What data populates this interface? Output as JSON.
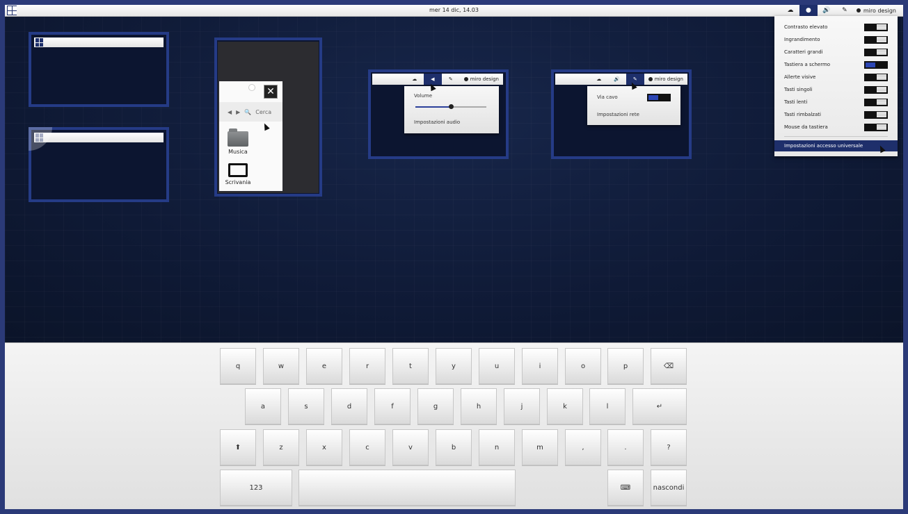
{
  "topbar": {
    "clock": "mer 14 dic, 14.03",
    "user": "miro design",
    "tray_icons": [
      "cloud-icon",
      "accessibility-icon",
      "volume-icon",
      "pencil-icon"
    ]
  },
  "file_manager": {
    "search": "Cerca",
    "items": [
      "Musica",
      "Scrivania"
    ]
  },
  "volume_popup": {
    "user": "miro design",
    "title": "Volume",
    "volume_level": 0.5,
    "settings": "Impostazioni audio"
  },
  "network_popup": {
    "user": "miro design",
    "wired": "Via cavo",
    "settings": "Impostazioni rete"
  },
  "accessibility_menu": {
    "items": [
      {
        "label": "Contrasto elevato",
        "on": false
      },
      {
        "label": "Ingrandimento",
        "on": false
      },
      {
        "label": "Caratteri grandi",
        "on": false
      },
      {
        "label": "Tastiera a schermo",
        "on": true
      },
      {
        "label": "Allerte visive",
        "on": false
      },
      {
        "label": "Tasti singoli",
        "on": false
      },
      {
        "label": "Tasti lenti",
        "on": false
      },
      {
        "label": "Tasti rimbalzati",
        "on": false
      },
      {
        "label": "Mouse da tastiera",
        "on": false
      }
    ],
    "footer": "Impostazioni accesso universale"
  },
  "keyboard": {
    "row1": [
      "q",
      "w",
      "e",
      "r",
      "t",
      "y",
      "u",
      "i",
      "o",
      "p",
      "⌫"
    ],
    "row2": [
      "a",
      "s",
      "d",
      "f",
      "g",
      "h",
      "j",
      "k",
      "l",
      "↵"
    ],
    "row3": [
      "⬆",
      "z",
      "x",
      "c",
      "v",
      "b",
      "n",
      "m",
      ",",
      ".",
      "?"
    ],
    "numbers": "123",
    "keyboard_icon": "⌨",
    "hide": "nascondi"
  }
}
